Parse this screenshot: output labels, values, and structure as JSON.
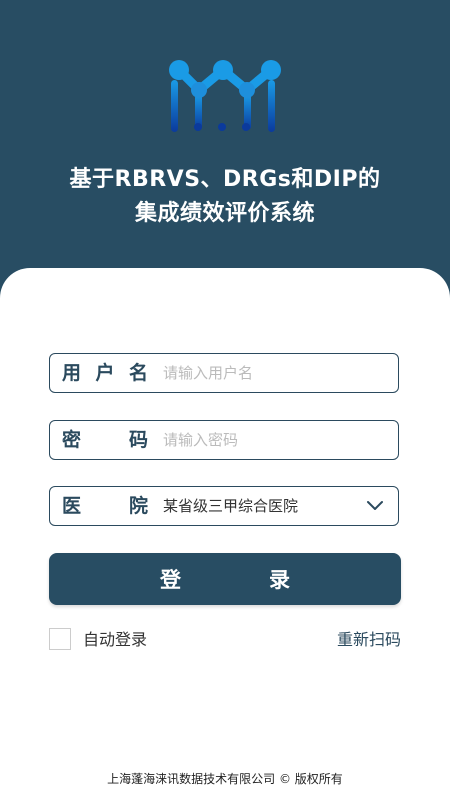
{
  "header": {
    "title_line1": "基于RBRVS、DRGs和DIP的",
    "title_line2": "集成绩效评价系统"
  },
  "form": {
    "username": {
      "label_chars": [
        "用",
        "户",
        "名"
      ],
      "placeholder": "请输入用户名",
      "value": ""
    },
    "password": {
      "label_chars": [
        "密",
        "码"
      ],
      "placeholder": "请输入密码",
      "value": ""
    },
    "hospital": {
      "label_chars": [
        "医",
        "院"
      ],
      "selected": "某省级三甲综合医院"
    },
    "login_chars": [
      "登",
      "录"
    ],
    "auto_login_label": "自动登录",
    "auto_login_checked": false,
    "rescan_label": "重新扫码"
  },
  "footer": {
    "copyright": "上海蓬海涞讯数据技术有限公司 © 版权所有"
  },
  "colors": {
    "primary": "#284d63",
    "logo_light": "#1a9be6",
    "logo_dark": "#0b3a9c",
    "placeholder": "#bbbbbb"
  },
  "icons": {
    "logo": "brand-logo-icon",
    "dropdown": "chevron-down-icon"
  }
}
